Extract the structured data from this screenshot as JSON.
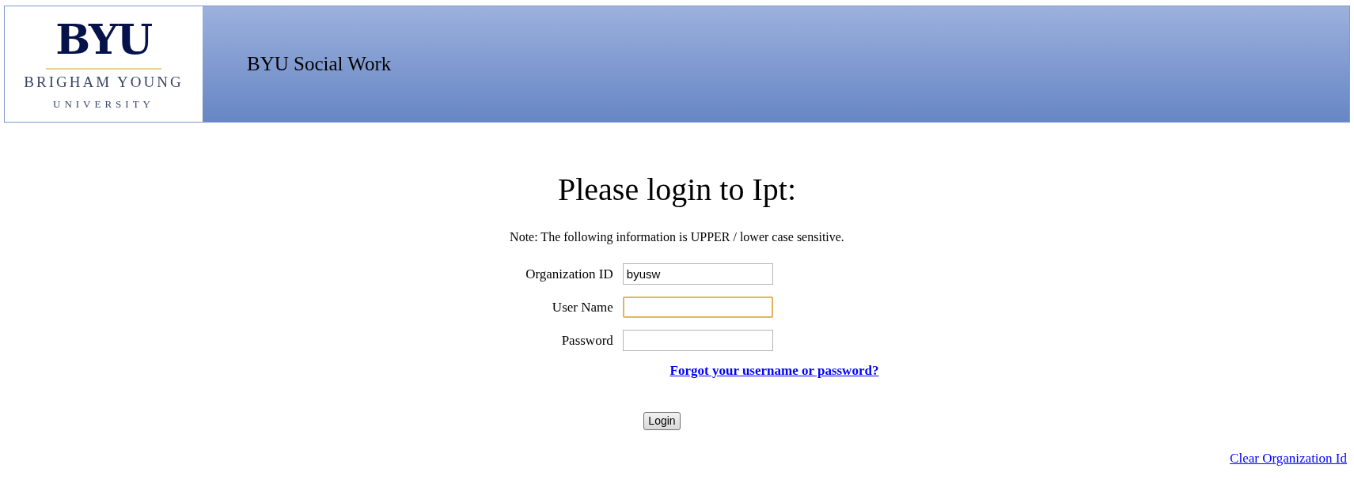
{
  "header": {
    "logo": {
      "wordmark": "BYU",
      "line_1": "BRIGHAM YOUNG",
      "line_2": "UNIVERSITY"
    },
    "title": "BYU Social Work"
  },
  "heading": "Please login to Ipt:",
  "note": "Note: The following information is UPPER / lower case sensitive.",
  "fields": [
    {
      "label": "Organization ID",
      "value": "byusw",
      "focused": false
    },
    {
      "label": "User Name",
      "focused": true
    },
    {
      "label": "Password",
      "focused": false
    }
  ],
  "forgot_link": "Forgot your username or password?",
  "login_button": "Login",
  "clear_link": "Clear Organization Id"
}
